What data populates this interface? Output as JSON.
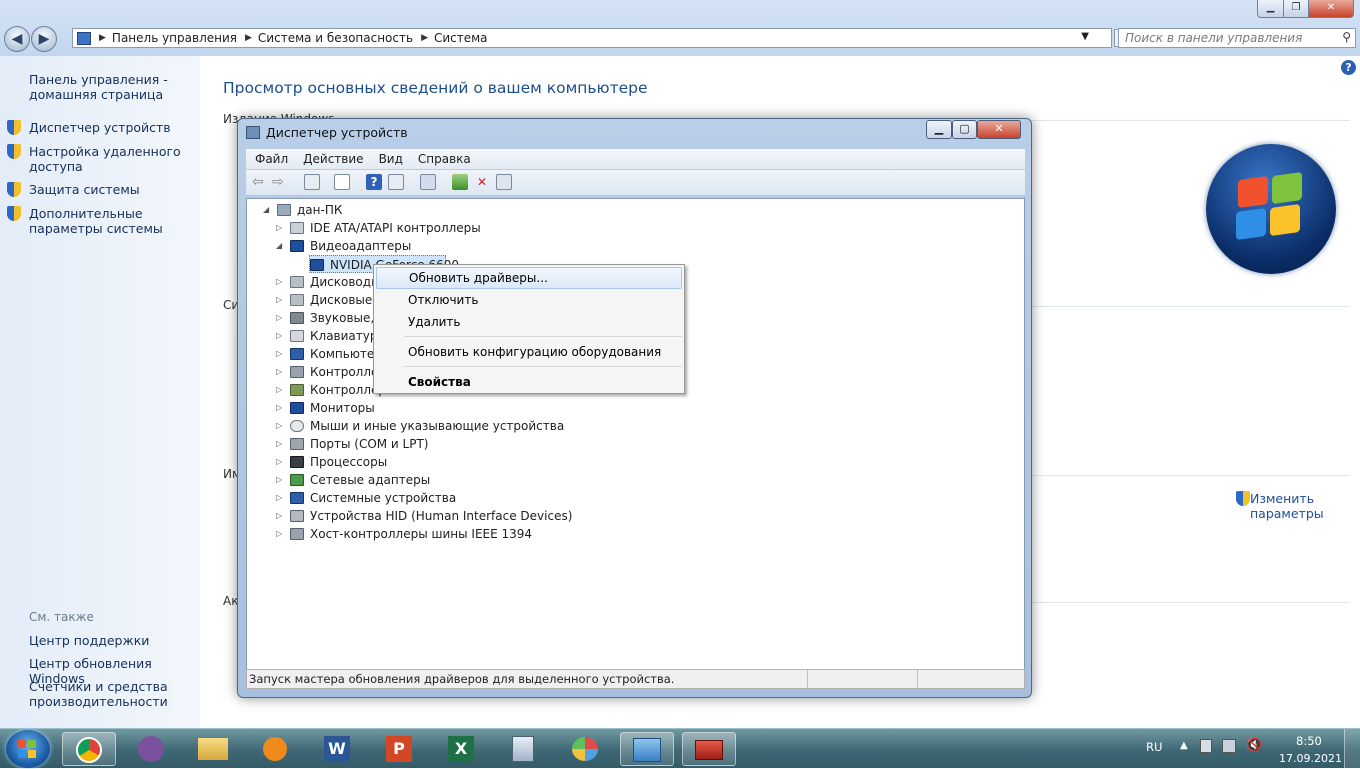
{
  "explorer": {
    "breadcrumb": [
      "Панель управления",
      "Система и безопасность",
      "Система"
    ],
    "search_placeholder": "Поиск в панели управления"
  },
  "sidebar": {
    "home": "Панель управления - домашняя страница",
    "items": [
      {
        "label": "Диспетчер устройств",
        "icon": "shield-icon"
      },
      {
        "label": "Настройка удаленного доступа",
        "icon": "shield-icon"
      },
      {
        "label": "Защита системы",
        "icon": "shield-icon"
      },
      {
        "label": "Дополнительные параметры системы",
        "icon": "shield-icon"
      }
    ],
    "see_also_title": "См. также",
    "see_also": [
      "Центр поддержки",
      "Центр обновления Windows",
      "Счетчики и средства производительности"
    ]
  },
  "main": {
    "title": "Просмотр основных сведений о вашем компьютере",
    "partial_labels": [
      "Издание Windows",
      "Си",
      "Им",
      "Ак"
    ],
    "change_settings": "Изменить параметры"
  },
  "device_manager": {
    "title": "Диспетчер устройств",
    "menu": [
      "Файл",
      "Действие",
      "Вид",
      "Справка"
    ],
    "tree": {
      "root": "дан-ПК",
      "nodes": [
        {
          "label": "IDE ATA/ATAPI контроллеры",
          "expanded": false
        },
        {
          "label": "Видеоадаптеры",
          "expanded": true
        },
        {
          "label": "NVIDIA GeForce 6600",
          "child": true,
          "selected": true
        },
        {
          "label": "Дисководы",
          "expanded": false
        },
        {
          "label": "Дисковые у",
          "expanded": false
        },
        {
          "label": "Звуковые, в",
          "expanded": false
        },
        {
          "label": "Клавиатуры",
          "expanded": false
        },
        {
          "label": "Компьютер",
          "expanded": false
        },
        {
          "label": "Контроллер",
          "expanded": false
        },
        {
          "label": "Контроллер",
          "expanded": false
        },
        {
          "label": "Мониторы",
          "expanded": false
        },
        {
          "label": "Мыши и иные указывающие устройства",
          "expanded": false
        },
        {
          "label": "Порты (COM и LPT)",
          "expanded": false
        },
        {
          "label": "Процессоры",
          "expanded": false
        },
        {
          "label": "Сетевые адаптеры",
          "expanded": false
        },
        {
          "label": "Системные устройства",
          "expanded": false
        },
        {
          "label": "Устройства HID (Human Interface Devices)",
          "expanded": false
        },
        {
          "label": "Хост-контроллеры шины IEEE 1394",
          "expanded": false
        }
      ]
    },
    "status": "Запуск мастера обновления драйверов для выделенного устройства."
  },
  "context_menu": {
    "items": [
      "Обновить драйверы...",
      "Отключить",
      "Удалить",
      "Обновить конфигурацию оборудования",
      "Свойства"
    ]
  },
  "taskbar": {
    "lang": "RU",
    "time": "8:50",
    "date": "17.09.2021",
    "apps": [
      "chrome-icon",
      "viber-icon",
      "explorer-icon",
      "media-player-icon",
      "word-icon",
      "powerpoint-icon",
      "excel-icon",
      "calculator-icon",
      "paint-icon",
      "control-panel-icon",
      "device-manager-icon"
    ]
  }
}
